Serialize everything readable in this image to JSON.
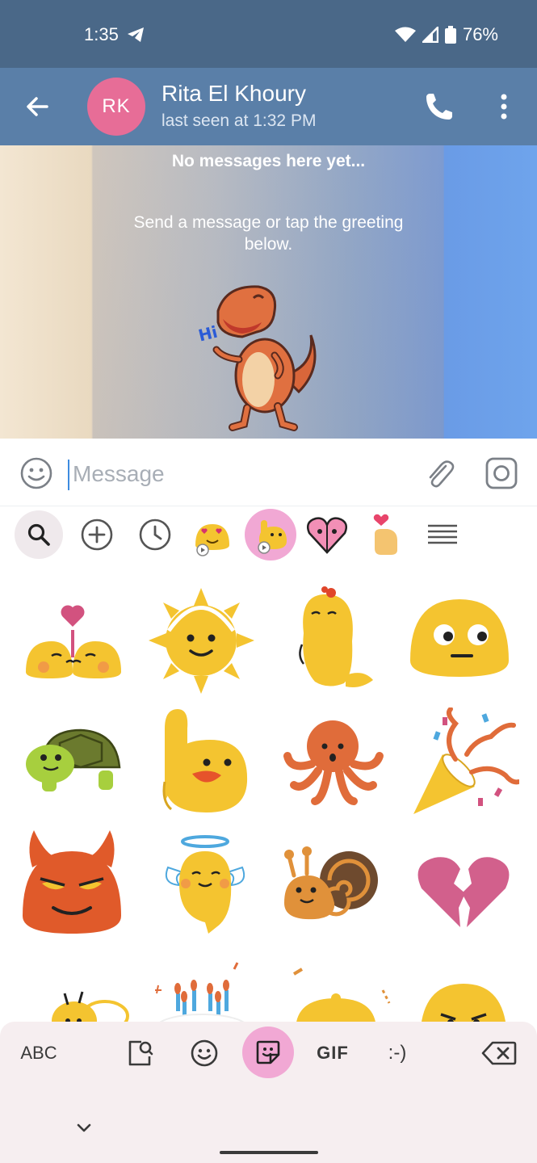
{
  "status_bar": {
    "time": "1:35",
    "battery": "76%"
  },
  "header": {
    "avatar_initials": "RK",
    "contact_name": "Rita El Khoury",
    "contact_status": "last seen at 1:32 PM"
  },
  "chat": {
    "empty_title": "No messages here yet...",
    "empty_description": "Send a message or tap the greeting below.",
    "sticker_text": "Hi"
  },
  "input": {
    "placeholder": "Message"
  },
  "sticker_tabs": [
    {
      "icon": "search-icon"
    },
    {
      "icon": "add-icon"
    },
    {
      "icon": "recent-clock-icon"
    },
    {
      "icon": "heart-eyes-blob-pack-icon"
    },
    {
      "icon": "waving-blob-pack-icon",
      "selected": true
    },
    {
      "icon": "heart-faces-pack-icon"
    },
    {
      "icon": "heart-hand-pack-icon"
    },
    {
      "icon": "menu-icon"
    }
  ],
  "stickers": [
    "kissing-blobs-sticker",
    "sun-sticker",
    "flower-blob-sticker",
    "side-eye-blob-sticker",
    "turtle-sticker",
    "raised-hand-blob-sticker",
    "octopus-sticker",
    "party-popper-sticker",
    "devil-blob-sticker",
    "angel-blob-sticker",
    "snail-sticker",
    "broken-heart-sticker",
    "bee-sticker",
    "birthday-cake-sticker",
    "bell-sticker",
    "angry-blob-sticker"
  ],
  "keyboard": {
    "abc_label": "ABC",
    "gif_label": "GIF",
    "emoticon_label": ":-)"
  },
  "colors": {
    "status_bar": "#4a6888",
    "header": "#5a7fa8",
    "avatar": "#e76d97",
    "selected_pink": "#f1a8d4",
    "blob_yellow": "#f4c430"
  }
}
